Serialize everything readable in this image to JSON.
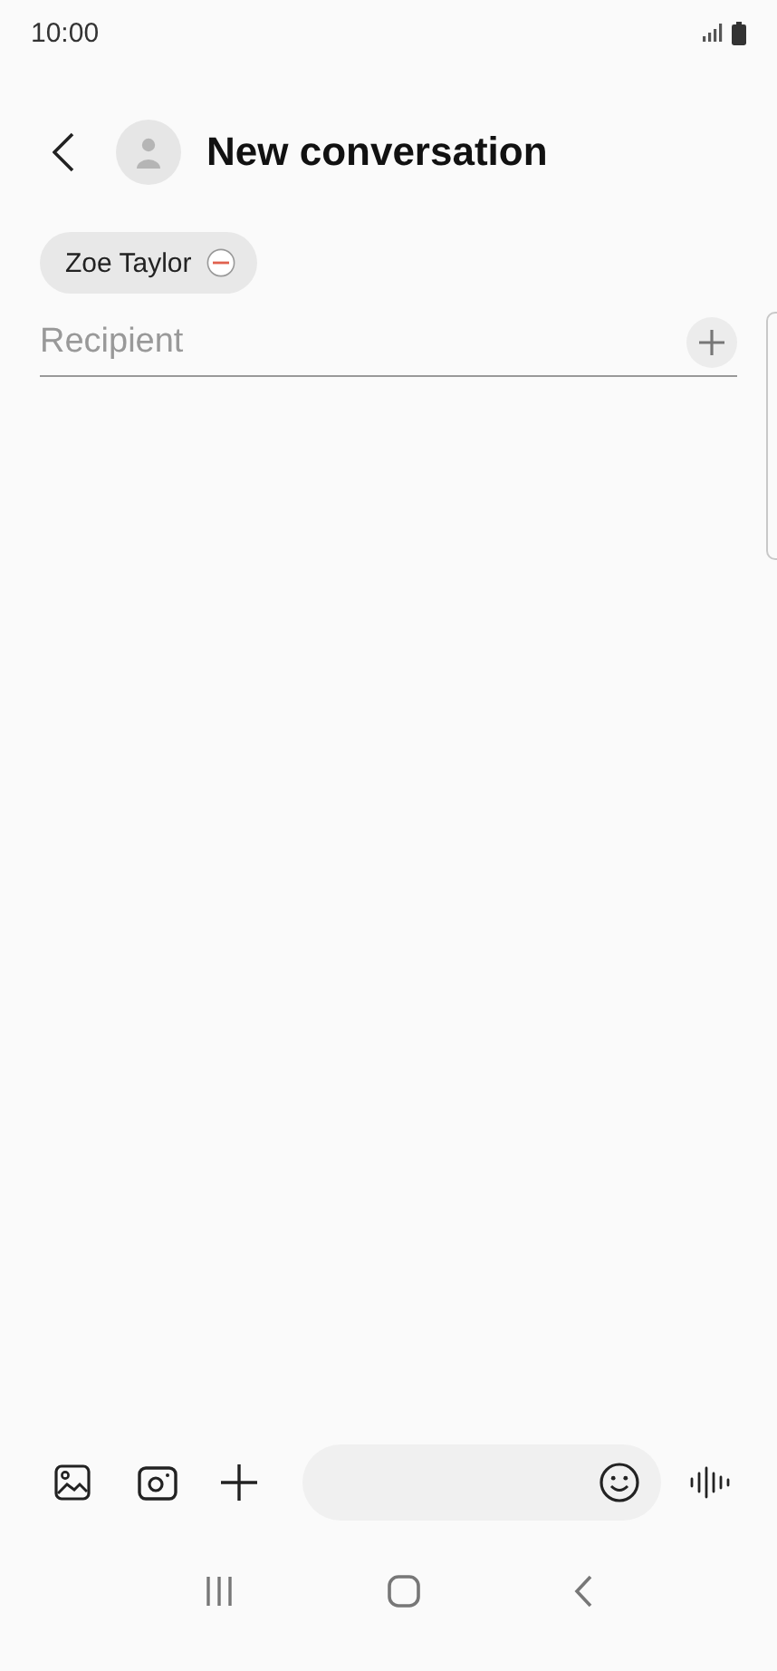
{
  "status_bar": {
    "time": "10:00"
  },
  "header": {
    "title": "New conversation"
  },
  "recipients": [
    {
      "name": "Zoe Taylor"
    }
  ],
  "recipient_field": {
    "placeholder": "Recipient"
  }
}
